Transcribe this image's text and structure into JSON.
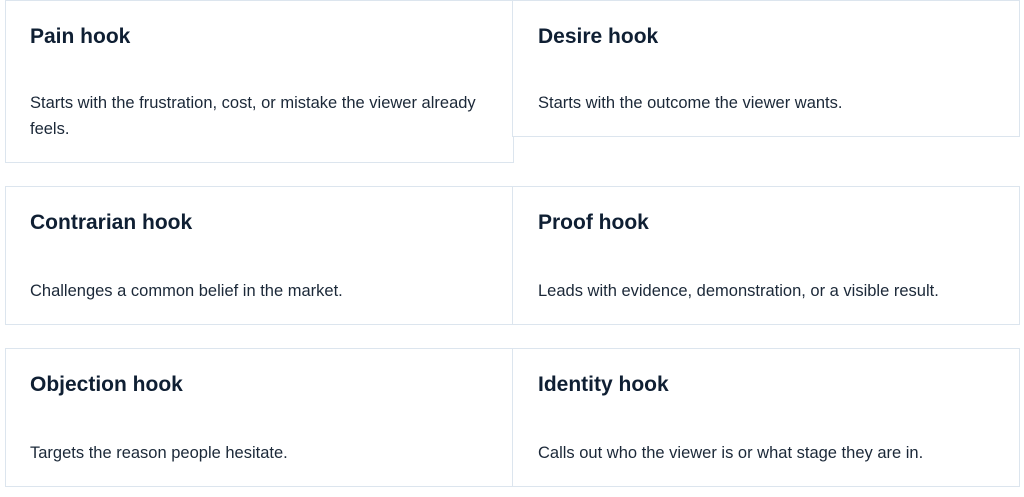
{
  "cards": [
    {
      "title": "Pain hook",
      "description": "Starts with the frustration, cost, or mistake the viewer already feels."
    },
    {
      "title": "Desire hook",
      "description": "Starts with the outcome the viewer wants."
    },
    {
      "title": "Contrarian hook",
      "description": "Challenges a common belief in the market."
    },
    {
      "title": "Proof hook",
      "description": "Leads with evidence, demonstration, or a visible result."
    },
    {
      "title": "Objection hook",
      "description": "Targets the reason people hesitate."
    },
    {
      "title": "Identity hook",
      "description": "Calls out who the viewer is or what stage they are in."
    }
  ]
}
